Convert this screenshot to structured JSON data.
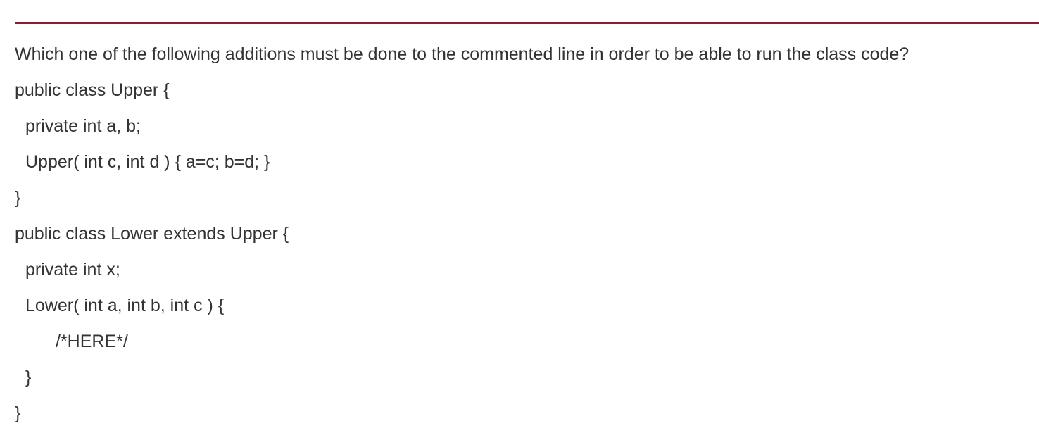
{
  "accent_color": "#8c1d2e",
  "question": "Which one of the following additions must be done to the commented line in order to be able to run the class code?",
  "code_lines": [
    "public class Upper {",
    "private int a, b;",
    "Upper( int c, int d ) { a=c; b=d; }",
    "}",
    "public class Lower extends Upper {",
    "private int x;",
    "Lower( int a, int b, int c ) {",
    "/*HERE*/",
    "}",
    "}"
  ]
}
